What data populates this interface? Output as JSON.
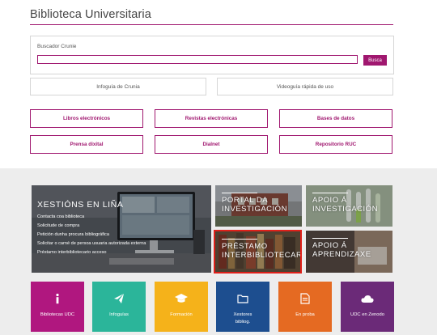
{
  "header": {
    "title": "Biblioteca Universitaria"
  },
  "search": {
    "label": "Buscador Crunie",
    "placeholder": "",
    "button_label": "Busca"
  },
  "guides": {
    "infoguide": "Infoguía de Crunia",
    "videoguide": "Videoguía rápida de uso"
  },
  "resources": [
    {
      "label": "Libros electrónicos"
    },
    {
      "label": "Revistas electrónicas"
    },
    {
      "label": "Bases de datos"
    },
    {
      "label": "Prensa dixital"
    },
    {
      "label": "Dialnet"
    },
    {
      "label": "Repositorio RUC"
    }
  ],
  "services": {
    "xestions": {
      "title": "XESTIÓNS EN LIÑA",
      "links": [
        "Contacta coa biblioteca",
        "Solicitude de compra",
        "Petición dunha procura bibliográfica",
        "Solicitar o carné de persoa usuaria autorizada externa",
        "Préstamo interbibliotecario acceso"
      ]
    },
    "portal": {
      "line1": "PORTAL DA",
      "line2": "INVESTIGACIÓN"
    },
    "apoio_investigacion": {
      "line1": "APOIO Á",
      "line2": "INVESTIGACIÓN"
    },
    "prestamo": {
      "line1": "PRÉSTAMO",
      "line2": "INTERBIBLIOTECARIO"
    },
    "apoio_aprendizaxe": {
      "line1": "APOIO Á",
      "line2": "APRENDIZAXE"
    }
  },
  "quicklinks": [
    {
      "label": "Bibliotecas UDC",
      "icon": "info-icon",
      "color": "#b0177f"
    },
    {
      "label": "Infoguías",
      "icon": "paper-plane-icon",
      "color": "#2bb59a"
    },
    {
      "label": "Formación",
      "icon": "graduation-cap-icon",
      "color": "#f5b21a"
    },
    {
      "label": "Xestores bibliog.",
      "icon": "folder-icon",
      "color": "#1d4e8f"
    },
    {
      "label": "En proba",
      "icon": "document-icon",
      "color": "#e56a22"
    },
    {
      "label": "UDC en Zenodo",
      "icon": "cloud-icon",
      "color": "#6b2a78"
    }
  ],
  "colors": {
    "accent": "#a0176f",
    "highlight_border": "#e0201a"
  }
}
